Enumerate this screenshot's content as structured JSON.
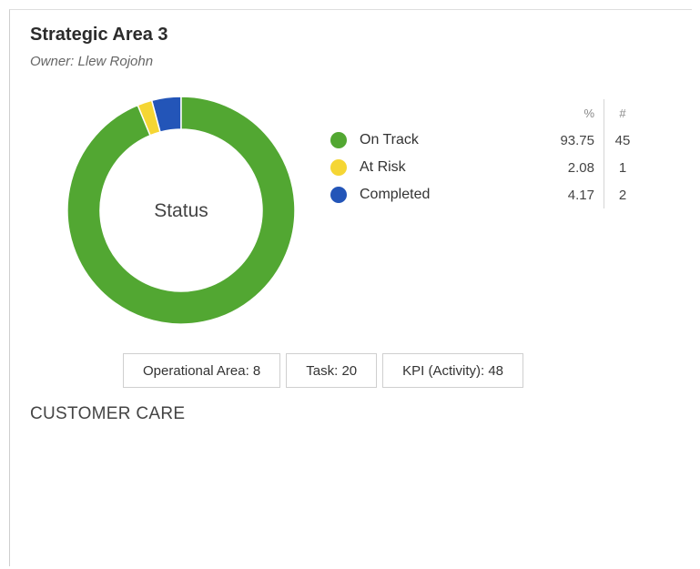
{
  "card": {
    "title": "Strategic Area 3",
    "owner": "Owner: Llew Rojohn"
  },
  "chart_data": {
    "type": "pie",
    "variant": "donut",
    "center_label": "Status",
    "categories": [
      "On Track",
      "At Risk",
      "Completed"
    ],
    "values": [
      93.75,
      2.08,
      4.17
    ],
    "counts": [
      45,
      1,
      2
    ],
    "colors": [
      "#52a732",
      "#f5d634",
      "#2355b8"
    ],
    "table_headers": {
      "percent": "%",
      "count": "#"
    },
    "legend_position": "right"
  },
  "buttons": {
    "operational_area": "Operational Area: 8",
    "task": "Task: 20",
    "kpi": "KPI (Activity): 48"
  },
  "section": {
    "label": "CUSTOMER CARE"
  }
}
